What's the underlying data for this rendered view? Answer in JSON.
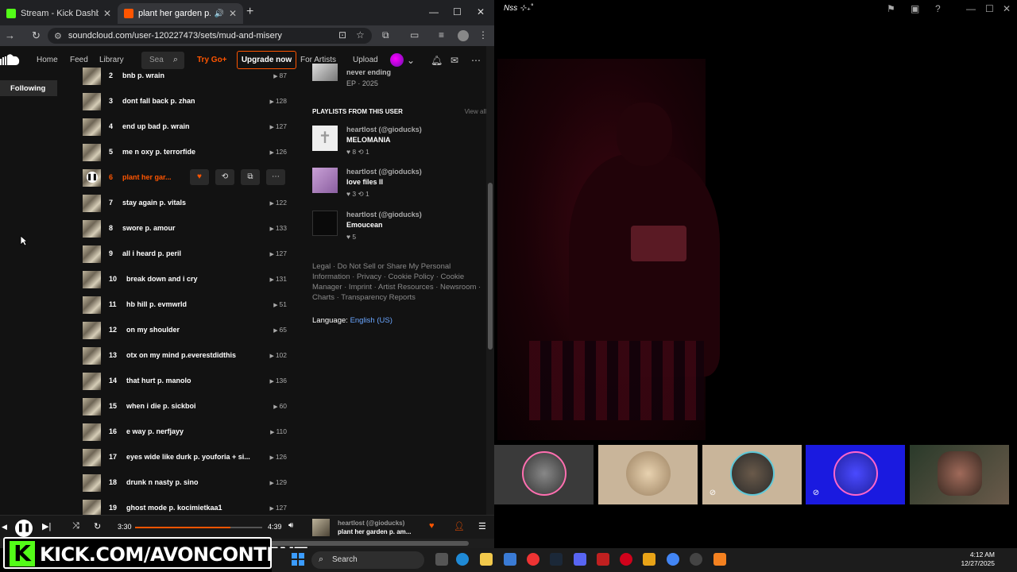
{
  "browser": {
    "tabs": [
      {
        "title": "Stream - Kick Dashboard",
        "favicon": "kick-icon"
      },
      {
        "title": "plant her garden p. amour",
        "favicon": "soundcloud-icon"
      }
    ],
    "new_tab": "+",
    "url": "soundcloud.com/user-120227473/sets/mud-and-misery",
    "window_controls": {
      "minimize": "—",
      "maximize": "☐",
      "close": "✕"
    }
  },
  "soundcloud": {
    "nav": {
      "home": "Home",
      "feed": "Feed",
      "library": "Library",
      "search_placeholder": "Sea",
      "try_go": "Try Go+",
      "upgrade": "Upgrade now",
      "for_artists": "For Artists",
      "upload": "Upload"
    },
    "sidebar": {
      "following": "Following"
    },
    "tracks": [
      {
        "num": "2",
        "title": "bnb p. wrain",
        "plays": "87"
      },
      {
        "num": "3",
        "title": "dont fall back p. zhan",
        "plays": "128"
      },
      {
        "num": "4",
        "title": "end up bad p. wrain",
        "plays": "127"
      },
      {
        "num": "5",
        "title": "me n oxy p. terrorfide",
        "plays": "126"
      },
      {
        "num": "6",
        "title": "plant her gar...",
        "plays": ""
      },
      {
        "num": "7",
        "title": "stay again p. vitals",
        "plays": "122"
      },
      {
        "num": "8",
        "title": "swore p. amour",
        "plays": "133"
      },
      {
        "num": "9",
        "title": "all i heard p. peril",
        "plays": "127"
      },
      {
        "num": "10",
        "title": "break down and i cry",
        "plays": "131"
      },
      {
        "num": "11",
        "title": "hb hill p. evmwrld",
        "plays": "51"
      },
      {
        "num": "12",
        "title": "on my shoulder",
        "plays": "65"
      },
      {
        "num": "13",
        "title": "otx on my mind p.everestdidthis",
        "plays": "102"
      },
      {
        "num": "14",
        "title": "that hurt p. manolo",
        "plays": "136"
      },
      {
        "num": "15",
        "title": "when i die p. sickboi",
        "plays": "60"
      },
      {
        "num": "16",
        "title": "e way p. nerfjayy",
        "plays": "110"
      },
      {
        "num": "17",
        "title": "eyes wide like durk p. youforia + si...",
        "plays": "126"
      },
      {
        "num": "18",
        "title": "drunk n nasty p. sino",
        "plays": "129"
      },
      {
        "num": "19",
        "title": "ghost mode p. kocimietkaa1",
        "plays": "127"
      }
    ],
    "active_track_index": 4,
    "ep": {
      "title": "never ending",
      "meta": "EP · 2025"
    },
    "playlists_header": "PLAYLISTS FROM THIS USER",
    "view_all": "View all",
    "playlists": [
      {
        "owner": "heartlost (@gioducks)",
        "name": "MELOMANIA",
        "stats": "♥ 8   ⟲ 1"
      },
      {
        "owner": "heartlost (@gioducks)",
        "name": "love files II",
        "stats": "♥ 3   ⟲ 1"
      },
      {
        "owner": "heartlost (@gioducks)",
        "name": "Emoucean",
        "stats": "♥ 5"
      }
    ],
    "footer_links": "Legal · Do Not Sell or Share My Personal Information · Privacy · Cookie Policy · Cookie Manager · Imprint · Artist Resources · Newsroom · Charts · Transparency Reports",
    "language_label": "Language:",
    "language_value": "English (US)",
    "player": {
      "elapsed": "3:30",
      "duration": "4:39",
      "progress": 0.75,
      "owner": "heartlost (@gioducks)",
      "title": "plant her garden p. am..."
    }
  },
  "stream": {
    "title": "Nss ⊹₊˚",
    "overlay": "KICK.COM/AVONCONTENT"
  },
  "taskbar": {
    "search": "Search",
    "time": "4:12 AM",
    "date": "12/27/2025"
  },
  "colors": {
    "accent": "#ff5500",
    "kick": "#53fc18"
  }
}
